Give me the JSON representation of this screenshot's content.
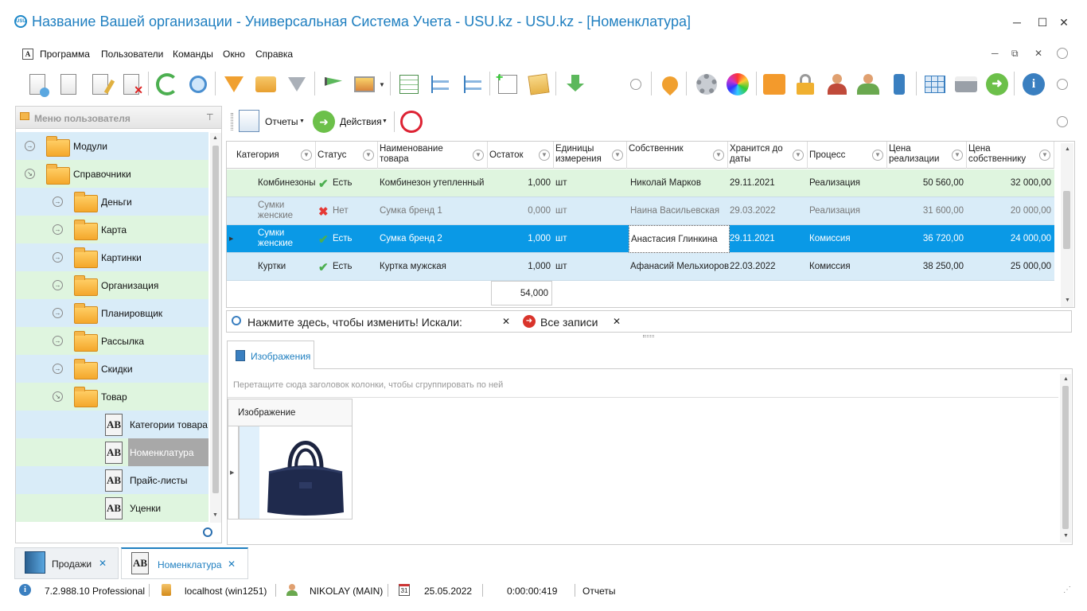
{
  "window": {
    "title": "Название Вашей организации - Универсальная Система Учета - USU.kz - USU.kz - [Номенклатура]",
    "logo_text": "USU",
    "minimize": "─",
    "maximize": "☐",
    "close": "✕"
  },
  "menu": {
    "items": [
      "Программа",
      "Пользователи",
      "Команды",
      "Окно",
      "Справка"
    ],
    "mdi_controls": [
      "─",
      "⧉",
      "✕"
    ]
  },
  "left_panel": {
    "title": "Меню пользователя",
    "pin": "⊤",
    "tree": [
      {
        "label": "Модули",
        "type": "folder",
        "level": 0,
        "expanded": false
      },
      {
        "label": "Справочники",
        "type": "folder",
        "level": 0,
        "expanded": true
      },
      {
        "label": "Деньги",
        "type": "folder",
        "level": 1,
        "expanded": false
      },
      {
        "label": "Карта",
        "type": "folder",
        "level": 1,
        "expanded": false
      },
      {
        "label": "Картинки",
        "type": "folder",
        "level": 1,
        "expanded": false
      },
      {
        "label": "Организация",
        "type": "folder",
        "level": 1,
        "expanded": false
      },
      {
        "label": "Планировщик",
        "type": "folder",
        "level": 1,
        "expanded": false
      },
      {
        "label": "Рассылка",
        "type": "folder",
        "level": 1,
        "expanded": false
      },
      {
        "label": "Скидки",
        "type": "folder",
        "level": 1,
        "expanded": false
      },
      {
        "label": "Товар",
        "type": "folder",
        "level": 1,
        "expanded": true
      },
      {
        "label": "Категории товара",
        "type": "report",
        "level": 2
      },
      {
        "label": "Номенклатура",
        "type": "report",
        "level": 2,
        "selected": true
      },
      {
        "label": "Прайс-листы",
        "type": "report",
        "level": 2
      },
      {
        "label": "Уценки",
        "type": "report",
        "level": 2
      }
    ],
    "ab_text": "AB"
  },
  "subtoolbar": {
    "reports_label": "Отчеты",
    "actions_label": "Действия"
  },
  "grid": {
    "columns": [
      "Категория",
      "Статус",
      "Наименование товара",
      "Остаток",
      "Единицы измерения",
      "Собственник",
      "Хранится до даты",
      "Процесс",
      "Цена реализации",
      "Цена собственнику"
    ],
    "rows": [
      {
        "category": "Комбинезоны",
        "status": "Есть",
        "status_ok": true,
        "name": "Комбинезон утепленный",
        "rest": "1,000",
        "unit": "шт",
        "owner": "Николай Марков",
        "date": "29.11.2021",
        "process": "Реализация",
        "price": "50 560,00",
        "owner_price": "32 000,00",
        "bg": "#dff5df"
      },
      {
        "category": "Сумки женские",
        "status": "Нет",
        "status_ok": false,
        "name": "Сумка бренд 1",
        "rest": "0,000",
        "unit": "шт",
        "owner": "Наина Васильевская",
        "date": "29.03.2022",
        "process": "Реализация",
        "price": "31 600,00",
        "owner_price": "20 000,00",
        "bg": "#d9ecf8",
        "muted": true
      },
      {
        "category": "Сумки женские",
        "status": "Есть",
        "status_ok": true,
        "name": "Сумка бренд 2",
        "rest": "1,000",
        "unit": "шт",
        "owner": "Анастасия Глинкина",
        "date": "29.11.2021",
        "process": "Комиссия",
        "price": "36 720,00",
        "owner_price": "24 000,00",
        "bg": "#0a99e6",
        "selected": true
      },
      {
        "category": "Куртки",
        "status": "Есть",
        "status_ok": true,
        "name": "Куртка мужская",
        "rest": "1,000",
        "unit": "шт",
        "owner": "Афанасий Мельхиоров",
        "date": "22.03.2022",
        "process": "Комиссия",
        "price": "38 250,00",
        "owner_price": "25 000,00",
        "bg": "#d9ecf8"
      }
    ],
    "total_rest": "54,000"
  },
  "find_panel": {
    "text": "Нажмите здесь, чтобы изменить! Искали:",
    "clear": "✕",
    "all_records": "Все записи",
    "all_clear": "✕"
  },
  "images_tab": {
    "tab_label": "Изображения",
    "group_hint": "Перетащите сюда заголовок колонки, чтобы сгруппировать по ней",
    "column": "Изображение"
  },
  "bottom_tabs": [
    {
      "label": "Продажи",
      "close": "✕"
    },
    {
      "label": "Номенклатура",
      "close": "✕",
      "active": true
    }
  ],
  "status": {
    "version": "7.2.988.10 Professional",
    "server": "localhost (win1251)",
    "user": "NIKOLAY (MAIN)",
    "date": "25.05.2022",
    "calendar_day": "31",
    "timer": "0:00:00:419",
    "mode": "Отчеты"
  },
  "colors": {
    "title": "#1f7fc0",
    "selected_row": "#0a99e6",
    "tree_blue": "#d9ecf8",
    "tree_green": "#dff5df"
  }
}
